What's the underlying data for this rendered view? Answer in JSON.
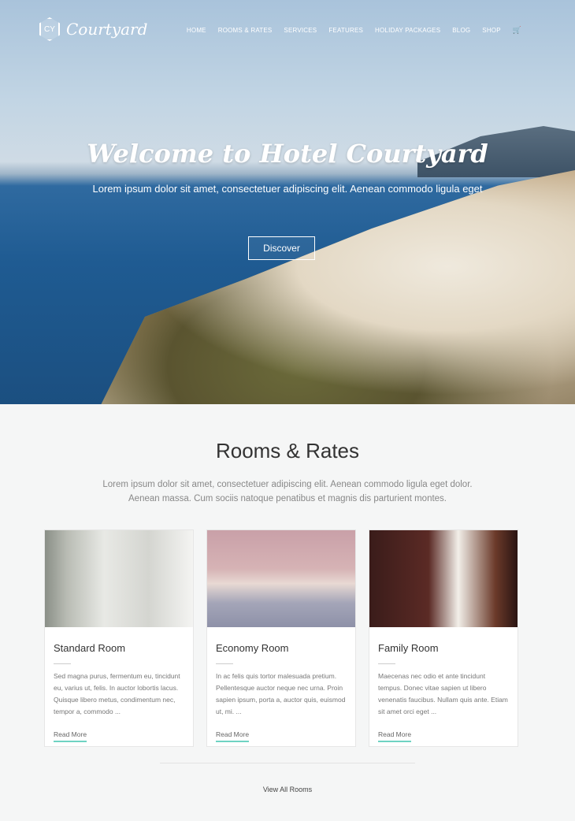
{
  "header": {
    "logo_mark": "CY",
    "brand": "Courtyard",
    "nav": [
      "HOME",
      "ROOMS & RATES",
      "SERVICES",
      "FEATURES",
      "HOLIDAY PACKAGES",
      "BLOG",
      "SHOP"
    ],
    "cart_icon": "cart-icon"
  },
  "hero": {
    "title": "Welcome to Hotel Courtyard",
    "subtitle": "Lorem ipsum dolor sit amet, consectetuer adipiscing elit. Aenean commodo ligula eget",
    "button": "Discover"
  },
  "rooms": {
    "title": "Rooms & Rates",
    "desc1": "Lorem ipsum dolor sit amet, consectetuer adipiscing elit. Aenean commodo ligula eget dolor.",
    "desc2": "Aenean massa. Cum sociis natoque penatibus et magnis dis parturient montes.",
    "cards": [
      {
        "name": "Standard Room",
        "text": "Sed magna purus, fermentum eu, tincidunt eu, varius ut, felis. In auctor lobortis lacus. Quisque libero metus, condimentum nec, tempor a, commodo ...",
        "link": "Read More"
      },
      {
        "name": "Economy Room",
        "text": "In ac felis quis tortor malesuada pretium. Pellentesque auctor neque nec urna. Proin sapien ipsum, porta a, auctor quis, euismod ut, mi. ...",
        "link": "Read More"
      },
      {
        "name": "Family Room",
        "text": "Maecenas nec odio et ante tincidunt tempus. Donec vitae sapien ut libero venenatis faucibus. Nullam quis ante. Etiam sit amet orci eget ...",
        "link": "Read More"
      }
    ],
    "view_all": "View All Rooms",
    "accent": "#6fd3c3"
  }
}
